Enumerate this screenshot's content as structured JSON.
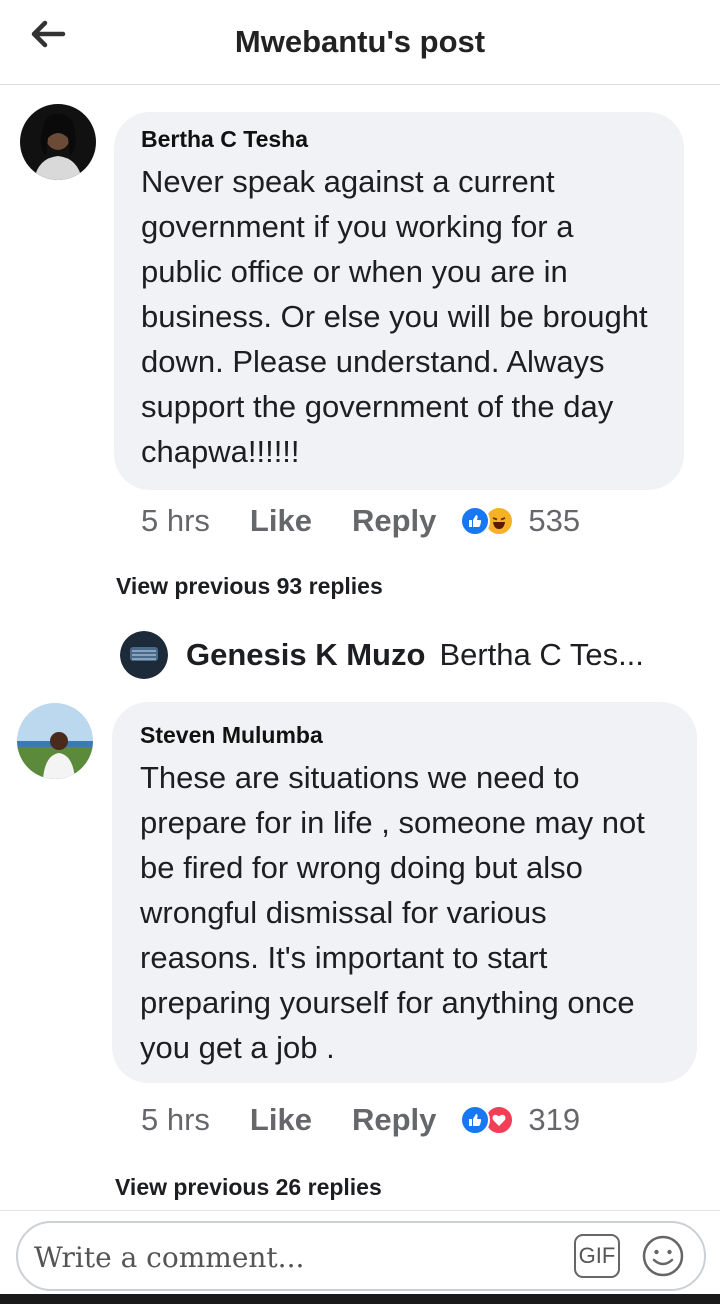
{
  "header": {
    "title": "Mwebantu's post",
    "back_icon": "arrow-left-icon"
  },
  "comments": [
    {
      "author": "Bertha C Tesha",
      "text": "Never speak against a current government if you working for a public office or when you are in business. Or else you will be brought down. Please understand. Always support the government of the day chapwa!!!!!!",
      "time": "5 hrs",
      "like_label": "Like",
      "reply_label": "Reply",
      "reactions": [
        "like-icon",
        "laugh-icon"
      ],
      "reaction_count": "535",
      "view_previous": "View previous 93 replies"
    },
    {
      "author": "Steven Mulumba",
      "text": "These are situations we need to prepare for in life , someone may not be fired for wrong doing but also wrongful dismissal for various reasons. It's important to start preparing yourself for anything once you get a job .",
      "time": "5 hrs",
      "like_label": "Like",
      "reply_label": "Reply",
      "reactions": [
        "like-icon",
        "love-icon"
      ],
      "reaction_count": "319",
      "view_previous": "View previous 26 replies"
    }
  ],
  "reply_preview": {
    "author": "Genesis K Muzo",
    "text": "Bertha C Tes..."
  },
  "composer": {
    "placeholder": "Write a comment...",
    "gif_label": "GIF",
    "emoji_icon": "smiley-icon"
  },
  "colors": {
    "like_blue": "#1877f2",
    "love_red": "#f33e58",
    "haha_yellow": "#f7b125",
    "bubble": "#f0f2f5",
    "meta_grey": "#65676b"
  }
}
